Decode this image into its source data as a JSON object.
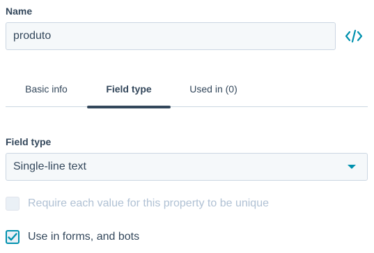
{
  "name": {
    "label": "Name",
    "value": "produto",
    "code_icon": "code-brackets-icon"
  },
  "tabs": [
    {
      "label": "Basic info",
      "active": false
    },
    {
      "label": "Field type",
      "active": true
    },
    {
      "label": "Used in (0)",
      "active": false
    }
  ],
  "field_type": {
    "label": "Field type",
    "selected": "Single-line text"
  },
  "options": {
    "unique": {
      "label": "Require each value for this property to be unique",
      "checked": false,
      "disabled": true
    },
    "forms": {
      "label": "Use in forms, and bots",
      "checked": true,
      "disabled": false
    }
  },
  "colors": {
    "accent": "#0091ae",
    "text": "#33475b",
    "disabled_text": "#b0c1d4",
    "input_bg": "#f5f8fa",
    "border": "#cbd6e2"
  }
}
